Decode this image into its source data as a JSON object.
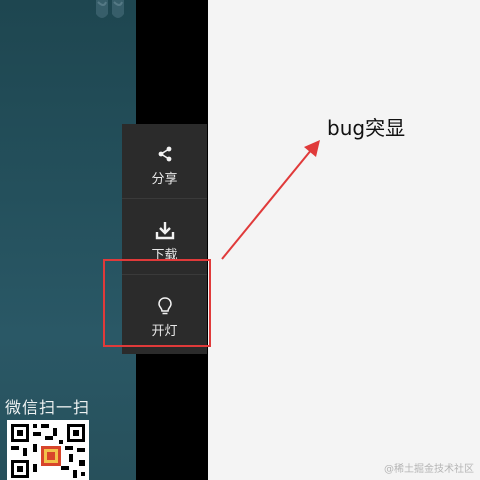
{
  "toolbar": {
    "items": [
      {
        "icon": "share-icon",
        "label": "分享"
      },
      {
        "icon": "download-icon",
        "label": "下载"
      },
      {
        "icon": "lightbulb-icon",
        "label": "开灯"
      }
    ]
  },
  "annotation": {
    "text": "bug突显",
    "color": "#e03a3a"
  },
  "sidebar": {
    "wechat_label": "微信扫一扫"
  },
  "watermark": "@稀土掘金技术社区",
  "colors": {
    "panel_bg": "#24505c",
    "toolbar_bg": "#2b2b2b",
    "page_bg": "#f4f4f4",
    "highlight": "#e03a3a"
  }
}
